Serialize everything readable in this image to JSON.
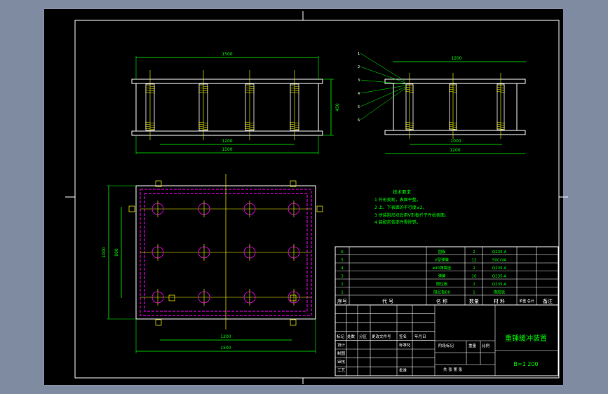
{
  "colors": {
    "background": "#7f8ba0",
    "paper": "#000000",
    "border": "#ffffff",
    "geometry": "#ffffff",
    "dimension": "#00ff00",
    "centerline": "#ffff00",
    "hidden": "#ff00ff",
    "spring": "#ffff00"
  },
  "front_view": {
    "dim_overall": "1500",
    "dim_inner": "1200",
    "dim_base": "1500",
    "dim_height": "450"
  },
  "side_view": {
    "dim_top": "1200",
    "dim_inner": "1000",
    "dim_base": "1200",
    "leaders": [
      "1",
      "2",
      "3",
      "4",
      "5",
      "6"
    ]
  },
  "plan_view": {
    "dim_bottom_inner": "1200",
    "dim_bottom_outer": "1500",
    "dim_left_outer": "1000",
    "dim_left_inner": "800"
  },
  "tech_requirements": {
    "title": "技术要求",
    "items": [
      "1 外形美观，表面平整。",
      "2 上、下表面的平行度≤2。",
      "3 拼装阻尼块后用V形板扦子件拢表面。",
      "4 装配前各部件需除锈。"
    ]
  },
  "bom": {
    "rows": [
      {
        "no": "6",
        "code": "",
        "name": "固板",
        "qty": "2",
        "mat": "Q235-A",
        "remark": ""
      },
      {
        "no": "5",
        "code": "",
        "name": "V型弹簧",
        "qty": "12",
        "mat": "50CrVA",
        "remark": ""
      },
      {
        "no": "4",
        "code": "",
        "name": "ø40弹簧座",
        "qty": "2",
        "mat": "Q235-A",
        "remark": ""
      },
      {
        "no": "3",
        "code": "",
        "name": "弹簧",
        "qty": "16",
        "mat": "Q235-A",
        "remark": ""
      },
      {
        "no": "2",
        "code": "",
        "name": "限位板",
        "qty": "2",
        "mat": "Q235-A",
        "remark": ""
      },
      {
        "no": "1",
        "code": "",
        "name": "阻尼板B8",
        "qty": "1",
        "mat": "橡胶板",
        "remark": ""
      }
    ],
    "header": {
      "no": "序号",
      "code": "代  号",
      "name": "名  称",
      "qty": "数量",
      "mat": "材 料",
      "unit": "单重  总计",
      "remark": "备注"
    }
  },
  "title_block": {
    "drawing_title": "重锤缓冲装置",
    "scale": "B=1 200",
    "cells": {
      "mark": "标记",
      "count": "处数",
      "zone": "分区",
      "change_doc": "更改文件号",
      "sign": "签名",
      "date": "年月日",
      "design": "设计",
      "standard": "标准化",
      "draw": "制图",
      "check": "审核",
      "process": "工艺",
      "approve": "批准",
      "stage": "阶段标记",
      "weight": "重量",
      "ratio": "比例",
      "sheets": "共    张  第    张"
    }
  }
}
